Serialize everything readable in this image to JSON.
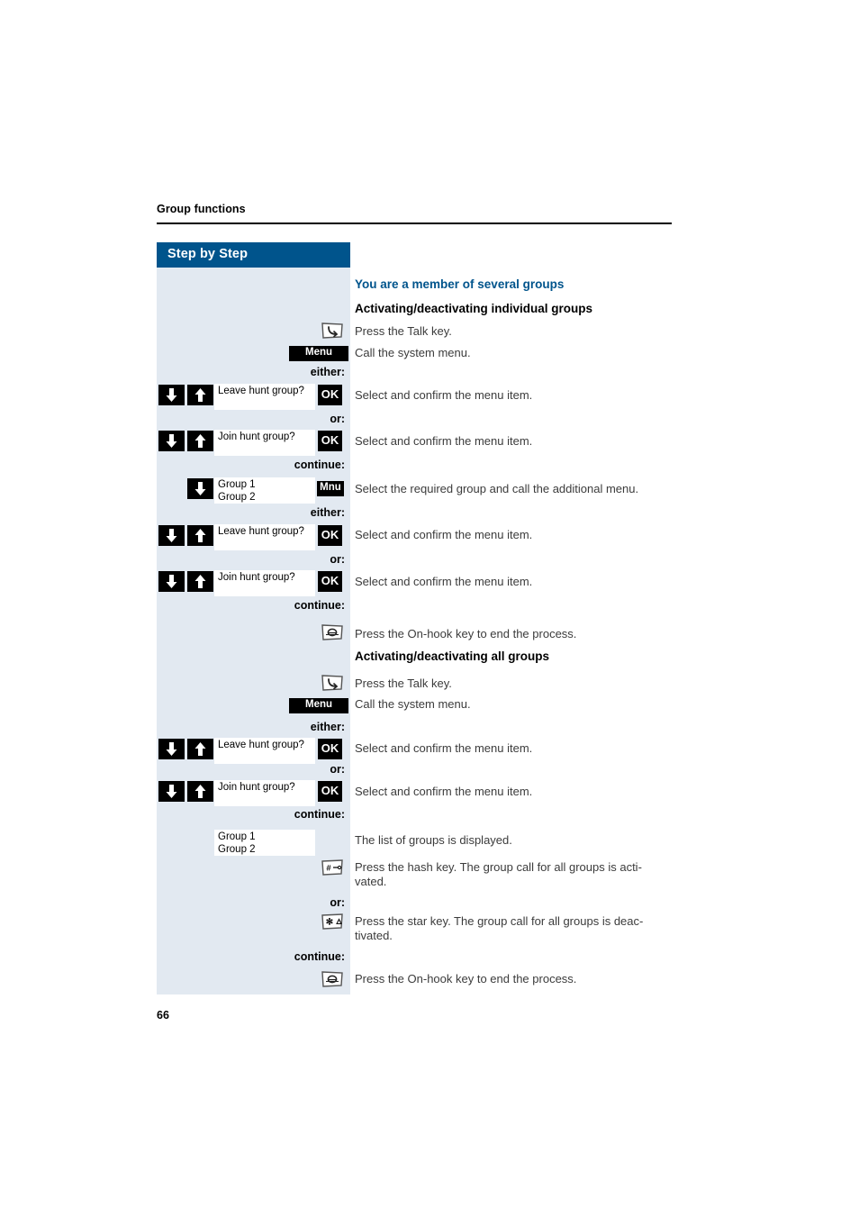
{
  "document": {
    "running_header": "Group functions",
    "page_number": "66",
    "sidebar_title": "Step by Step",
    "accent_color": "#00548c",
    "sidebar_bg": "#e2e9f1"
  },
  "headings": {
    "section": "You are a member of several groups",
    "sub1": "Activating/deactivating individual groups",
    "sub2": "Activating/deactivating all groups"
  },
  "connectors": {
    "either": "either:",
    "or": "or:",
    "continue": "continue:"
  },
  "keys": {
    "talk": "talk-key",
    "onhook": "on-hook-key",
    "hash": "hash-key",
    "star": "star-key",
    "arrow_down": "arrow-down-key",
    "arrow_up": "arrow-up-key"
  },
  "softkeys": {
    "menu": "Menu",
    "mnu": "Mnu",
    "ok": "OK"
  },
  "display": {
    "leave": "Leave hunt group?",
    "join": "Join hunt group?",
    "group1": "Group 1",
    "group2": "Group 2"
  },
  "instructions": {
    "press_talk": "Press the Talk key.",
    "call_menu": "Call the system menu.",
    "select_confirm": "Select and confirm the menu item.",
    "select_group": "Select the required group and call the additional menu.",
    "press_onhook": "Press the On-hook key to end the process.",
    "list_displayed": "The list of groups is displayed.",
    "press_hash": "Press the hash key. The group call for all groups is acti-\nvated.",
    "press_star": "Press the star key. The group call for all groups is deac-\ntivated."
  }
}
